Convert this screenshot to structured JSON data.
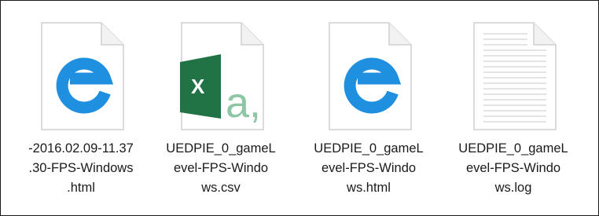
{
  "files": [
    {
      "icon": "edge-html-file-icon",
      "name_lines": [
        "-2016.02.09-11.37",
        ".30-FPS-Windows",
        ".html"
      ]
    },
    {
      "icon": "excel-csv-file-icon",
      "name_lines": [
        "UEDPIE_0_gameL",
        "evel-FPS-Windo",
        "ws.csv"
      ]
    },
    {
      "icon": "edge-html-file-icon",
      "name_lines": [
        "UEDPIE_0_gameL",
        "evel-FPS-Windo",
        "ws.html"
      ]
    },
    {
      "icon": "text-log-file-icon",
      "name_lines": [
        "UEDPIE_0_gameL",
        "evel-FPS-Windo",
        "ws.log"
      ]
    }
  ],
  "colors": {
    "edge_blue": "#1f8fe0",
    "excel_green": "#217346",
    "excel_light_green": "#8cc6a4"
  }
}
